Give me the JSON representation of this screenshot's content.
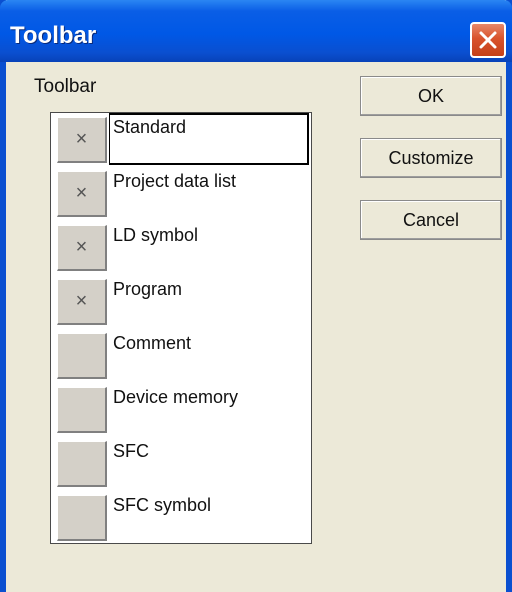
{
  "window": {
    "title": "Toolbar"
  },
  "group_label": "Toolbar",
  "toolbars": [
    {
      "label": "Standard",
      "checked": true,
      "mark": "×",
      "selected": true
    },
    {
      "label": "Project data list",
      "checked": true,
      "mark": "×",
      "selected": false
    },
    {
      "label": "LD symbol",
      "checked": true,
      "mark": "×",
      "selected": false
    },
    {
      "label": "Program",
      "checked": true,
      "mark": "×",
      "selected": false
    },
    {
      "label": "Comment",
      "checked": false,
      "mark": "",
      "selected": false
    },
    {
      "label": "Device memory",
      "checked": false,
      "mark": "",
      "selected": false
    },
    {
      "label": "SFC",
      "checked": false,
      "mark": "",
      "selected": false
    },
    {
      "label": "SFC symbol",
      "checked": false,
      "mark": "",
      "selected": false
    }
  ],
  "buttons": {
    "ok": "OK",
    "customize": "Customize",
    "cancel": "Cancel"
  },
  "colors": {
    "titlebar": "#0058e6",
    "close": "#d9532c",
    "face": "#ece9d8",
    "checkbox": "#d4d0c8"
  },
  "icons": {
    "close": "close-icon"
  }
}
